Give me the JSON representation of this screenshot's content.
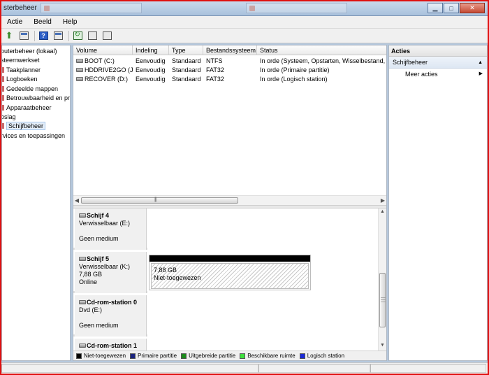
{
  "window": {
    "title": "sterbeheer"
  },
  "menu": {
    "items": [
      "Actie",
      "Beeld",
      "Help"
    ]
  },
  "tree": {
    "items": [
      {
        "label": "outerbeheer (lokaal)",
        "dot": false
      },
      {
        "label": "steemwerkset",
        "dot": false
      },
      {
        "label": "Taakplanner",
        "dot": true
      },
      {
        "label": "Logboeken",
        "dot": true
      },
      {
        "label": "Gedeelde mappen",
        "dot": true
      },
      {
        "label": "Betrouwbaarheid en pre",
        "dot": true
      },
      {
        "label": "Apparaatbeheer",
        "dot": true
      },
      {
        "label": "oslag",
        "dot": false
      },
      {
        "label": "Schijfbeheer",
        "dot": true,
        "selected": true
      },
      {
        "label": "rvices en toepassingen",
        "dot": false
      }
    ]
  },
  "volumes": {
    "columns": [
      "Volume",
      "Indeling",
      "Type",
      "Bestandssysteem",
      "Status"
    ],
    "rows": [
      [
        "BOOT (C:)",
        "Eenvoudig",
        "Standaard",
        "NTFS",
        "In orde (Systeem, Opstarten, Wisselbestand, A"
      ],
      [
        "HDDRIVE2GO (J:)",
        "Eenvoudig",
        "Standaard",
        "FAT32",
        "In orde (Primaire partitie)"
      ],
      [
        "RECOVER (D:)",
        "Eenvoudig",
        "Standaard",
        "FAT32",
        "In orde (Logisch station)"
      ]
    ]
  },
  "disks": [
    {
      "name": "Schijf 4",
      "lines": [
        "Verwisselbaar (E:)",
        "",
        "Geen medium"
      ],
      "partition": null
    },
    {
      "name": "Schijf 5",
      "lines": [
        "Verwisselbaar (K:)",
        "7,88 GB",
        "Online"
      ],
      "partition": {
        "size": "7,88 GB",
        "state": "Niet-toegewezen"
      }
    },
    {
      "name": "Cd-rom-station 0",
      "lines": [
        "Dvd (E:)",
        "",
        "Geen medium"
      ],
      "partition": null
    },
    {
      "name": "Cd-rom-station 1",
      "lines": [],
      "partition": null
    }
  ],
  "legend": [
    {
      "label": "Niet-toegewezen",
      "color": "#000000"
    },
    {
      "label": "Primaire partitie",
      "color": "#1a237e"
    },
    {
      "label": "Uitgebreide partitie",
      "color": "#1b8a1b"
    },
    {
      "label": "Beschikbare ruimte",
      "color": "#3de03d"
    },
    {
      "label": "Logisch station",
      "color": "#1a2ad8"
    }
  ],
  "actions": {
    "header": "Acties",
    "section": "Schijfbeheer",
    "more": "Meer acties"
  },
  "colors": {
    "accent_frame": "#e01010",
    "titlebar": "#b5c8dd"
  }
}
